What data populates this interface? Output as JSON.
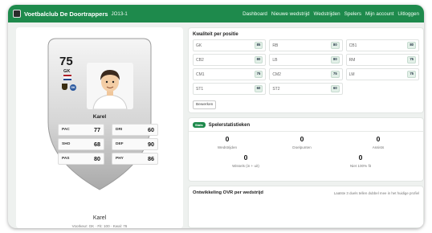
{
  "navbar": {
    "brand": "Voetbalclub De Doortrappers",
    "team": "JO13-1",
    "links": [
      "Dashboard",
      "Nieuwe wedstrijd",
      "Wedstrijden",
      "Spelers",
      "Mijn account",
      "Uitloggen"
    ],
    "color": "#1e8a4c"
  },
  "card": {
    "rating": "75",
    "position": "GK",
    "badge": "GK",
    "name": "Karel",
    "stats": [
      {
        "key": "PAC",
        "value": "77"
      },
      {
        "key": "DRI",
        "value": "60"
      },
      {
        "key": "SHO",
        "value": "68"
      },
      {
        "key": "DEF",
        "value": "90"
      },
      {
        "key": "PAS",
        "value": "80"
      },
      {
        "key": "PHY",
        "value": "86"
      }
    ]
  },
  "player": {
    "name": "Karel",
    "subtitle": "Voorkeur: GK · Fit: 100 · Kwal: 76"
  },
  "quality": {
    "title": "Kwaliteit per positie",
    "positions": [
      {
        "pos": "GK",
        "rating": "85"
      },
      {
        "pos": "RB",
        "rating": "80"
      },
      {
        "pos": "CB1",
        "rating": "80"
      },
      {
        "pos": "CB2",
        "rating": "80"
      },
      {
        "pos": "LB",
        "rating": "80"
      },
      {
        "pos": "RM",
        "rating": "75"
      },
      {
        "pos": "CM1",
        "rating": "75"
      },
      {
        "pos": "CM2",
        "rating": "75"
      },
      {
        "pos": "LM",
        "rating": "75"
      },
      {
        "pos": "ST1",
        "rating": "60"
      },
      {
        "pos": "ST2",
        "rating": "60"
      }
    ],
    "edit_label": "Bewerken"
  },
  "stats": {
    "badge": "Stats",
    "title": "Spelerstatistieken",
    "metrics": [
      {
        "value": "0",
        "label": "Wedstrijden"
      },
      {
        "value": "0",
        "label": "Doelpunten"
      },
      {
        "value": "0",
        "label": "Assists"
      },
      {
        "value": "0",
        "label": "Wissels (in + uit)"
      },
      {
        "value": "0",
        "label": "Niet 100% fit"
      }
    ]
  },
  "development": {
    "title": "Ontwikkeling OVR per wedstrijd",
    "note": "Laatste 3 duels tellen dubbel mee in het huidige profiel"
  }
}
